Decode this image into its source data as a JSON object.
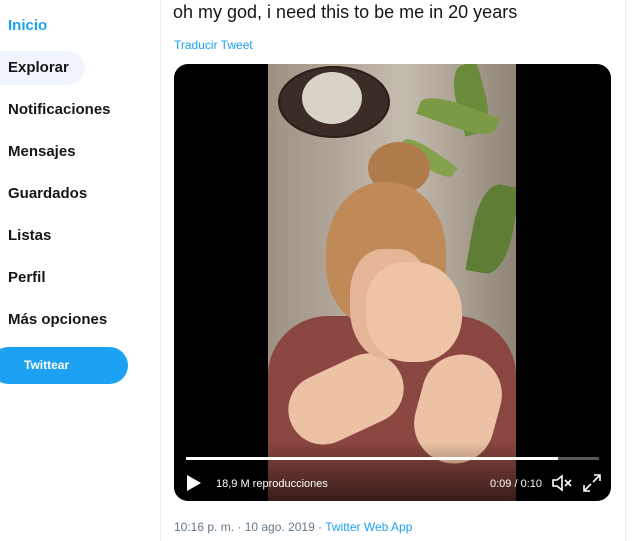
{
  "sidebar": {
    "items": [
      {
        "label": "Inicio",
        "active": true
      },
      {
        "label": "Explorar"
      },
      {
        "label": "Notificaciones"
      },
      {
        "label": "Mensajes"
      },
      {
        "label": "Guardados"
      },
      {
        "label": "Listas"
      },
      {
        "label": "Perfil"
      },
      {
        "label": "Más opciones"
      }
    ],
    "tweet_button": "Twittear"
  },
  "tweet": {
    "text": "oh my god, i need this to be me in 20 years",
    "translate": "Traducir Tweet",
    "video": {
      "views": "18,9 M reproducciones",
      "time": "0:09 / 0:10",
      "progress": 0.9
    },
    "timestamp": "10:16 p. m. · 10 ago. 2019",
    "separator": " · ",
    "source": "Twitter Web App"
  },
  "colors": {
    "accent": "#1da1f2",
    "text": "#14171a",
    "muted": "#657786"
  }
}
